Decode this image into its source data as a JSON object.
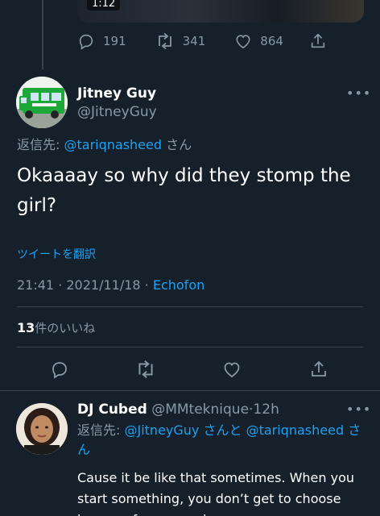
{
  "previous_tweet": {
    "video_time": "1:12",
    "actions": {
      "replies": "191",
      "retweets": "341",
      "likes": "864"
    }
  },
  "main_tweet": {
    "display_name": "Jitney Guy",
    "handle": "@JitneyGuy",
    "more": "•••",
    "replying_label": "返信先: ",
    "replying_handle": "@tariqnasheed",
    "replying_suffix": " さん",
    "text": "Okaaaay so why did they stomp the girl?",
    "translate": "ツイートを翻訳",
    "timestamp": "21:41 · 2021/11/18 · ",
    "source": "Echofon",
    "likes_count": "13",
    "likes_label": "件のいいね"
  },
  "reply_tweet": {
    "display_name": "DJ Cubed",
    "handle": "@MMteknique",
    "time": "12h",
    "more": "•••",
    "replying_label": "返信先: ",
    "handle1": "@JitneyGuy",
    "joiner": " さんと ",
    "handle2": "@tariqnasheed",
    "suffix": " さん",
    "text": "Cause it be like that sometimes. When you start something, you don’t get to choose how a mfer responds."
  },
  "colors": {
    "background": "#15202b",
    "accent": "#1da1f2",
    "muted": "#8899a6",
    "divider": "#38444d"
  }
}
